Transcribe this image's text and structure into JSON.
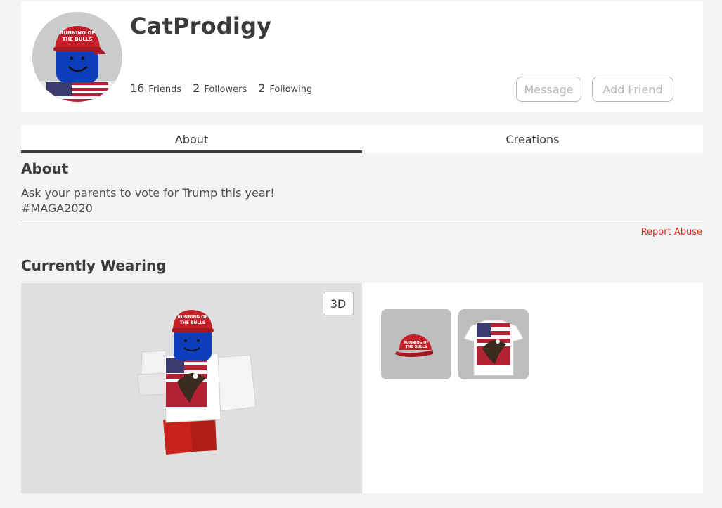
{
  "profile": {
    "username": "CatProdigy",
    "stats": [
      {
        "count": "16",
        "label": "Friends"
      },
      {
        "count": "2",
        "label": "Followers"
      },
      {
        "count": "2",
        "label": "Following"
      }
    ],
    "message_label": "Message",
    "add_friend_label": "Add Friend",
    "hat_text_line1": "RUNNING OF",
    "hat_text_line2": "THE BULLS"
  },
  "tabs": [
    {
      "label": "About",
      "active": true
    },
    {
      "label": "Creations",
      "active": false
    }
  ],
  "about": {
    "title": "About",
    "text": "Ask your parents to vote for Trump this year!\n#MAGA2020",
    "report_label": "Report Abuse"
  },
  "wearing": {
    "title": "Currently Wearing",
    "view_toggle": "3D",
    "items": [
      {
        "icon": "red-cap-icon"
      },
      {
        "icon": "eagle-tshirt-icon"
      }
    ]
  },
  "colors": {
    "accent_red": "#e2231a",
    "text": "#393b3d",
    "page_bg": "#f2f4f5"
  }
}
